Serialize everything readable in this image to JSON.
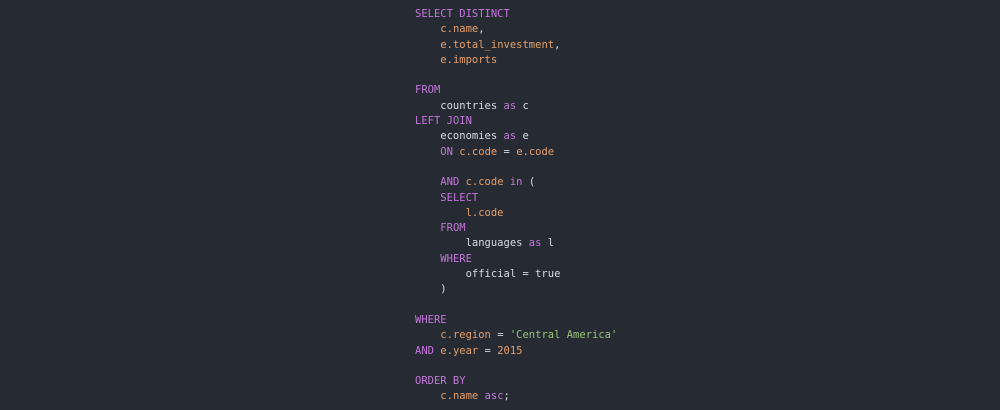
{
  "colors": {
    "background": "#262a33",
    "keyword": "#c678dd",
    "identifier": "#e5a06a",
    "string": "#98c379",
    "text": "#d7dbe2"
  },
  "code": [
    [
      {
        "k": "kw",
        "t": "SELECT DISTINCT"
      }
    ],
    [
      {
        "k": "txt",
        "t": "    "
      },
      {
        "k": "id",
        "t": "c.name"
      },
      {
        "k": "txt",
        "t": ","
      }
    ],
    [
      {
        "k": "txt",
        "t": "    "
      },
      {
        "k": "id",
        "t": "e.total_investment"
      },
      {
        "k": "txt",
        "t": ","
      }
    ],
    [
      {
        "k": "txt",
        "t": "    "
      },
      {
        "k": "id",
        "t": "e.imports"
      }
    ],
    [],
    [
      {
        "k": "kw",
        "t": "FROM"
      }
    ],
    [
      {
        "k": "txt",
        "t": "    countries "
      },
      {
        "k": "kw",
        "t": "as"
      },
      {
        "k": "txt",
        "t": " c"
      }
    ],
    [
      {
        "k": "kw",
        "t": "LEFT JOIN"
      }
    ],
    [
      {
        "k": "txt",
        "t": "    economies "
      },
      {
        "k": "kw",
        "t": "as"
      },
      {
        "k": "txt",
        "t": " e"
      }
    ],
    [
      {
        "k": "txt",
        "t": "    "
      },
      {
        "k": "kw",
        "t": "ON"
      },
      {
        "k": "txt",
        "t": " "
      },
      {
        "k": "id",
        "t": "c.code"
      },
      {
        "k": "txt",
        "t": " = "
      },
      {
        "k": "id",
        "t": "e.code"
      }
    ],
    [],
    [
      {
        "k": "txt",
        "t": "    "
      },
      {
        "k": "kw",
        "t": "AND"
      },
      {
        "k": "txt",
        "t": " "
      },
      {
        "k": "id",
        "t": "c.code"
      },
      {
        "k": "txt",
        "t": " "
      },
      {
        "k": "kw",
        "t": "in"
      },
      {
        "k": "txt",
        "t": " ("
      }
    ],
    [
      {
        "k": "txt",
        "t": "    "
      },
      {
        "k": "kw",
        "t": "SELECT"
      }
    ],
    [
      {
        "k": "txt",
        "t": "        "
      },
      {
        "k": "id",
        "t": "l.code"
      }
    ],
    [
      {
        "k": "txt",
        "t": "    "
      },
      {
        "k": "kw",
        "t": "FROM"
      }
    ],
    [
      {
        "k": "txt",
        "t": "        languages "
      },
      {
        "k": "kw",
        "t": "as"
      },
      {
        "k": "txt",
        "t": " l"
      }
    ],
    [
      {
        "k": "txt",
        "t": "    "
      },
      {
        "k": "kw",
        "t": "WHERE"
      }
    ],
    [
      {
        "k": "txt",
        "t": "        official = true"
      }
    ],
    [
      {
        "k": "txt",
        "t": "    )"
      }
    ],
    [],
    [
      {
        "k": "kw",
        "t": "WHERE"
      }
    ],
    [
      {
        "k": "txt",
        "t": "    "
      },
      {
        "k": "id",
        "t": "c.region"
      },
      {
        "k": "txt",
        "t": " = "
      },
      {
        "k": "str",
        "t": "'Central America'"
      }
    ],
    [
      {
        "k": "kw",
        "t": "AND"
      },
      {
        "k": "txt",
        "t": " "
      },
      {
        "k": "id",
        "t": "e.year"
      },
      {
        "k": "txt",
        "t": " = "
      },
      {
        "k": "num",
        "t": "2015"
      }
    ],
    [],
    [
      {
        "k": "kw",
        "t": "ORDER BY"
      }
    ],
    [
      {
        "k": "txt",
        "t": "    "
      },
      {
        "k": "id",
        "t": "c.name"
      },
      {
        "k": "txt",
        "t": " "
      },
      {
        "k": "kw",
        "t": "asc"
      },
      {
        "k": "txt",
        "t": ";"
      }
    ]
  ]
}
